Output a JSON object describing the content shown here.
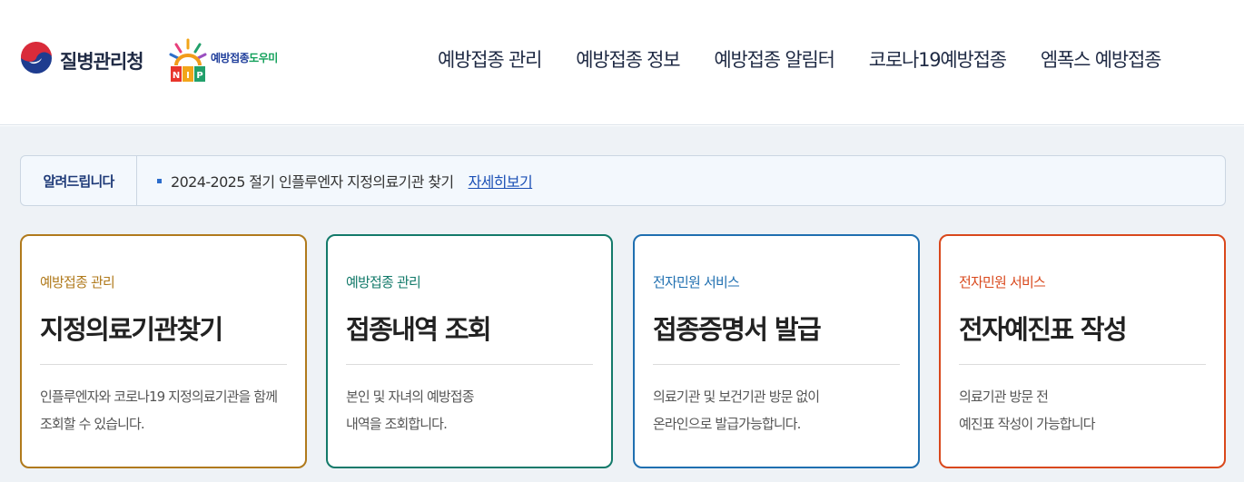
{
  "header": {
    "agency_name": "질병관리청",
    "brand": {
      "part1": "예방접종",
      "part2": "도우미",
      "badge": "NIP"
    },
    "nav": [
      {
        "label": "예방접종 관리"
      },
      {
        "label": "예방접종 정보"
      },
      {
        "label": "예방접종 알림터"
      },
      {
        "label": "코로나19예방접종"
      },
      {
        "label": "엠폭스 예방접종"
      }
    ]
  },
  "notice": {
    "label": "알려드립니다",
    "text": "2024-2025 절기 인플루엔자 지정의료기관 찾기",
    "link": "자세히보기"
  },
  "cards": [
    {
      "category": "예방접종 관리",
      "title": "지정의료기관찾기",
      "desc": "인플루엔자와 코로나19 지정의료기관을 함께\n조회할 수 있습니다.",
      "color": "#b07a1c"
    },
    {
      "category": "예방접종 관리",
      "title": "접종내역 조회",
      "desc": "본인 및 자녀의 예방접종\n내역을 조회합니다.",
      "color": "#137a6a"
    },
    {
      "category": "전자민원 서비스",
      "title": "접종증명서 발급",
      "desc": "의료기관 및 보건기관 방문 없이\n온라인으로 발급가능합니다.",
      "color": "#1f6fb0"
    },
    {
      "category": "전자민원 서비스",
      "title": "전자예진표 작성",
      "desc": "의료기관 방문 전\n예진표 작성이 가능합니다",
      "color": "#d9481c"
    }
  ],
  "colors": {
    "gov_blue": "#1e3c8f",
    "gov_red": "#d92b3a",
    "header_text": "#1f2a44",
    "content_bg": "#eef2f6"
  }
}
